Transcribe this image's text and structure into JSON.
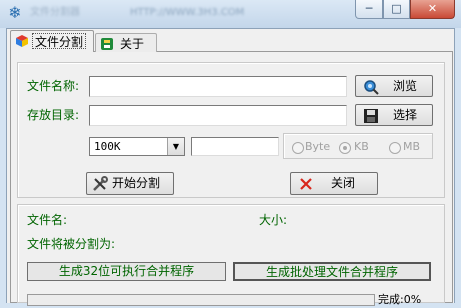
{
  "window": {
    "icon": "snowflake-icon",
    "title_blurred": "文件分割器",
    "title_url_blurred": "HTTP://WWW.3H3.COM",
    "minimize_glyph": "─",
    "maximize_glyph": "□",
    "close_glyph": "✕"
  },
  "tabs": [
    {
      "label": "文件分割",
      "icon": "colorful-cube-icon",
      "selected": true
    },
    {
      "label": "关于",
      "icon": "green-app-icon",
      "selected": false
    }
  ],
  "form": {
    "filename_label": "文件名称:",
    "filename_value": "",
    "browse_label": "浏览",
    "browse_icon": "search-globe-icon",
    "dir_label": "存放目录:",
    "dir_value": "",
    "select_label": "选择",
    "select_icon": "floppy-disk-icon",
    "size_value": "100K",
    "size_custom_value": "",
    "units": [
      {
        "label": "Byte",
        "checked": false
      },
      {
        "label": "KB",
        "checked": true
      },
      {
        "label": "MB",
        "checked": false
      }
    ]
  },
  "actions": {
    "start_label": "开始分割",
    "start_icon": "tools-icon",
    "close_label": "关闭",
    "close_icon": "red-x-icon"
  },
  "info": {
    "filename_label": "文件名:",
    "size_label": "大小:",
    "split_into_label": "文件将被分割为:",
    "gen32_label": "生成32位可执行合并程序",
    "genbatch_label": "生成批处理文件合并程序",
    "done_label": "完成:0%"
  },
  "colors": {
    "label_green": "#006400",
    "close_button_red": "#c94a36",
    "disabled_gray": "#a0a0a0"
  }
}
